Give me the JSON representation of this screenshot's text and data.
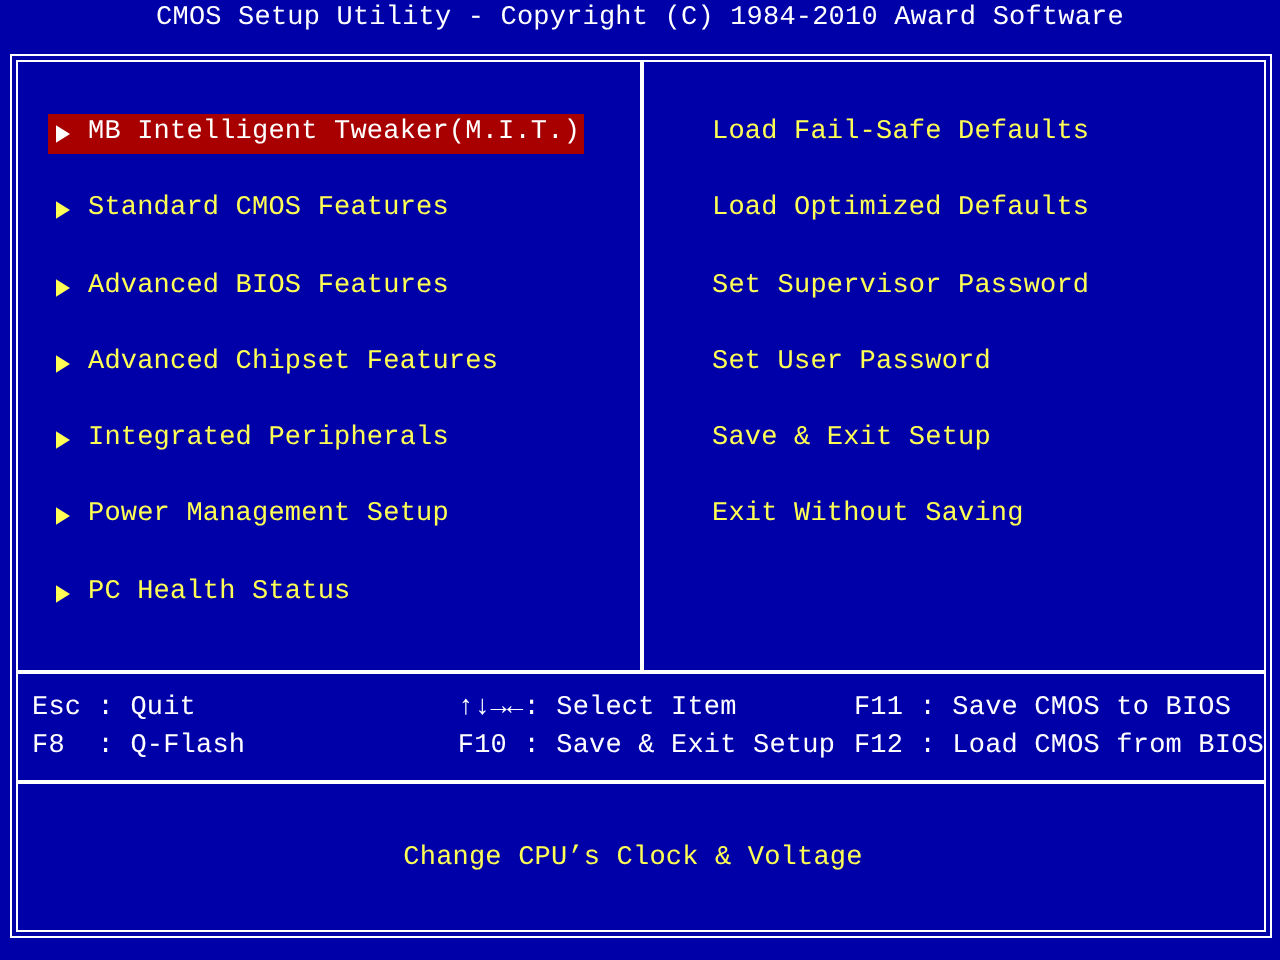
{
  "title": "CMOS Setup Utility - Copyright (C) 1984-2010 Award Software",
  "left_menu": [
    {
      "label": "MB Intelligent Tweaker(M.I.T.)",
      "selected": true
    },
    {
      "label": "Standard CMOS Features",
      "selected": false
    },
    {
      "label": "Advanced BIOS Features",
      "selected": false
    },
    {
      "label": "Advanced Chipset Features",
      "selected": false
    },
    {
      "label": "Integrated Peripherals",
      "selected": false
    },
    {
      "label": "Power Management Setup",
      "selected": false
    },
    {
      "label": "PC Health Status",
      "selected": false
    }
  ],
  "right_menu": [
    {
      "label": "Load Fail-Safe Defaults",
      "selected": false
    },
    {
      "label": "Load Optimized Defaults",
      "selected": false
    },
    {
      "label": "Set Supervisor Password",
      "selected": false
    },
    {
      "label": "Set User Password",
      "selected": false
    },
    {
      "label": "Save & Exit Setup",
      "selected": false
    },
    {
      "label": "Exit Without Saving",
      "selected": false
    }
  ],
  "key_help": [
    [
      "Esc : Quit",
      "F8  : Q-Flash"
    ],
    [
      "↑↓→←: Select Item",
      "F10 : Save & Exit Setup"
    ],
    [
      "F11 : Save CMOS to BIOS",
      "F12 : Load CMOS from BIOS"
    ]
  ],
  "help_text": "Change CPU’s Clock & Voltage"
}
